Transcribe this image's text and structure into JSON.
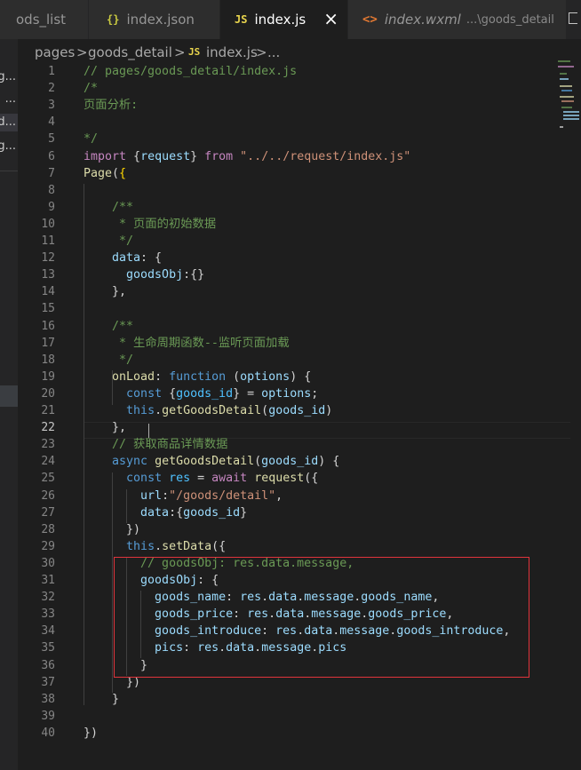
{
  "tabs": [
    {
      "label": "ods_list",
      "icon": "",
      "hint": "",
      "active": false
    },
    {
      "label": "index.json",
      "icon": "{}",
      "hint": "",
      "active": false
    },
    {
      "label": "index.js",
      "icon": "JS",
      "hint": "",
      "active": true,
      "close": "×"
    },
    {
      "label": "index.wxml",
      "icon": "<>",
      "hint": "...\\goods_detail",
      "active": false
    }
  ],
  "breadcrumb": {
    "part1": "pages",
    "sep": ">",
    "part2": "goods_detail",
    "icon": "JS",
    "file": "index.js",
    "ellipsis": "..."
  },
  "sidebar": {
    "items": [
      "g...",
      "...",
      "d...",
      "g..."
    ]
  },
  "editor": {
    "current_line": 22,
    "lines": [
      {
        "n": "1",
        "t": [
          [
            "// pages/goods_detail/index.js",
            "#6a9955"
          ]
        ]
      },
      {
        "n": "2",
        "t": [
          [
            "/*",
            "#6a9955"
          ]
        ]
      },
      {
        "n": "3",
        "t": [
          [
            "页面分析:",
            "#6a9955"
          ]
        ]
      },
      {
        "n": "4",
        "t": []
      },
      {
        "n": "5",
        "t": [
          [
            "*/",
            "#6a9955"
          ]
        ]
      },
      {
        "n": "6",
        "t": [
          [
            "import",
            "#c586c0"
          ],
          [
            " {",
            "#d4d4d4"
          ],
          [
            "request",
            "#9cdcfe"
          ],
          [
            "} ",
            "#d4d4d4"
          ],
          [
            "from",
            "#c586c0"
          ],
          [
            " ",
            "#d4d4d4"
          ],
          [
            "\"../../request/index.js\"",
            "#ce9178"
          ]
        ]
      },
      {
        "n": "7",
        "t": [
          [
            "Page",
            "#dcdcaa"
          ],
          [
            "(",
            "#d4d4d4"
          ],
          [
            "{",
            "#ffd700"
          ]
        ]
      },
      {
        "n": "8",
        "t": []
      },
      {
        "n": "9",
        "t": [
          [
            "    /**",
            "#6a9955"
          ]
        ]
      },
      {
        "n": "10",
        "t": [
          [
            "     * 页面的初始数据",
            "#6a9955"
          ]
        ]
      },
      {
        "n": "11",
        "t": [
          [
            "     */",
            "#6a9955"
          ]
        ]
      },
      {
        "n": "12",
        "t": [
          [
            "    data",
            "#9cdcfe"
          ],
          [
            ": {",
            "#d4d4d4"
          ]
        ]
      },
      {
        "n": "13",
        "t": [
          [
            "      goodsObj",
            "#9cdcfe"
          ],
          [
            ":{}",
            "#d4d4d4"
          ]
        ]
      },
      {
        "n": "14",
        "t": [
          [
            "    },",
            "#d4d4d4"
          ]
        ]
      },
      {
        "n": "15",
        "t": []
      },
      {
        "n": "16",
        "t": [
          [
            "    /**",
            "#6a9955"
          ]
        ]
      },
      {
        "n": "17",
        "t": [
          [
            "     * 生命周期函数--监听页面加载",
            "#6a9955"
          ]
        ]
      },
      {
        "n": "18",
        "t": [
          [
            "     */",
            "#6a9955"
          ]
        ]
      },
      {
        "n": "19",
        "t": [
          [
            "    onLoad",
            "#dcdcaa"
          ],
          [
            ": ",
            "#d4d4d4"
          ],
          [
            "function",
            "#569cd6"
          ],
          [
            " (",
            "#d4d4d4"
          ],
          [
            "options",
            "#9cdcfe"
          ],
          [
            ") {",
            "#d4d4d4"
          ]
        ]
      },
      {
        "n": "20",
        "t": [
          [
            "      ",
            "#d4d4d4"
          ],
          [
            "const",
            "#569cd6"
          ],
          [
            " {",
            "#d4d4d4"
          ],
          [
            "goods_id",
            "#4fc1ff"
          ],
          [
            "} = ",
            "#d4d4d4"
          ],
          [
            "options",
            "#9cdcfe"
          ],
          [
            ";",
            "#d4d4d4"
          ]
        ]
      },
      {
        "n": "21",
        "t": [
          [
            "      ",
            "#d4d4d4"
          ],
          [
            "this",
            "#569cd6"
          ],
          [
            ".",
            "#d4d4d4"
          ],
          [
            "getGoodsDetail",
            "#dcdcaa"
          ],
          [
            "(",
            "#d4d4d4"
          ],
          [
            "goods_id",
            "#9cdcfe"
          ],
          [
            ")",
            "#d4d4d4"
          ]
        ]
      },
      {
        "n": "22",
        "t": [
          [
            "    },",
            "#d4d4d4"
          ]
        ]
      },
      {
        "n": "23",
        "t": [
          [
            "    // 获取商品详情数据",
            "#6a9955"
          ]
        ]
      },
      {
        "n": "24",
        "t": [
          [
            "    ",
            "#d4d4d4"
          ],
          [
            "async",
            "#569cd6"
          ],
          [
            " ",
            "#d4d4d4"
          ],
          [
            "getGoodsDetail",
            "#dcdcaa"
          ],
          [
            "(",
            "#d4d4d4"
          ],
          [
            "goods_id",
            "#9cdcfe"
          ],
          [
            ") {",
            "#d4d4d4"
          ]
        ]
      },
      {
        "n": "25",
        "t": [
          [
            "      ",
            "#d4d4d4"
          ],
          [
            "const",
            "#569cd6"
          ],
          [
            " ",
            "#d4d4d4"
          ],
          [
            "res",
            "#4fc1ff"
          ],
          [
            " = ",
            "#d4d4d4"
          ],
          [
            "await",
            "#c586c0"
          ],
          [
            " ",
            "#d4d4d4"
          ],
          [
            "request",
            "#dcdcaa"
          ],
          [
            "({",
            "#d4d4d4"
          ]
        ]
      },
      {
        "n": "26",
        "t": [
          [
            "        url",
            "#9cdcfe"
          ],
          [
            ":",
            "#d4d4d4"
          ],
          [
            "\"/goods/detail\"",
            "#ce9178"
          ],
          [
            ",",
            "#d4d4d4"
          ]
        ]
      },
      {
        "n": "27",
        "t": [
          [
            "        data",
            "#9cdcfe"
          ],
          [
            ":{",
            "#d4d4d4"
          ],
          [
            "goods_id",
            "#9cdcfe"
          ],
          [
            "}",
            "#d4d4d4"
          ]
        ]
      },
      {
        "n": "28",
        "t": [
          [
            "      })",
            "#d4d4d4"
          ]
        ]
      },
      {
        "n": "29",
        "t": [
          [
            "      ",
            "#d4d4d4"
          ],
          [
            "this",
            "#569cd6"
          ],
          [
            ".",
            "#d4d4d4"
          ],
          [
            "setData",
            "#dcdcaa"
          ],
          [
            "({",
            "#d4d4d4"
          ]
        ]
      },
      {
        "n": "30",
        "t": [
          [
            "        // goodsObj: res.data.message,",
            "#6a9955"
          ]
        ]
      },
      {
        "n": "31",
        "t": [
          [
            "        goodsObj",
            "#9cdcfe"
          ],
          [
            ": {",
            "#d4d4d4"
          ]
        ]
      },
      {
        "n": "32",
        "t": [
          [
            "          goods_name",
            "#9cdcfe"
          ],
          [
            ": ",
            "#d4d4d4"
          ],
          [
            "res",
            "#9cdcfe"
          ],
          [
            ".",
            "#d4d4d4"
          ],
          [
            "data",
            "#9cdcfe"
          ],
          [
            ".",
            "#d4d4d4"
          ],
          [
            "message",
            "#9cdcfe"
          ],
          [
            ".",
            "#d4d4d4"
          ],
          [
            "goods_name",
            "#9cdcfe"
          ],
          [
            ",",
            "#d4d4d4"
          ]
        ]
      },
      {
        "n": "33",
        "t": [
          [
            "          goods_price",
            "#9cdcfe"
          ],
          [
            ": ",
            "#d4d4d4"
          ],
          [
            "res",
            "#9cdcfe"
          ],
          [
            ".",
            "#d4d4d4"
          ],
          [
            "data",
            "#9cdcfe"
          ],
          [
            ".",
            "#d4d4d4"
          ],
          [
            "message",
            "#9cdcfe"
          ],
          [
            ".",
            "#d4d4d4"
          ],
          [
            "goods_price",
            "#9cdcfe"
          ],
          [
            ",",
            "#d4d4d4"
          ]
        ]
      },
      {
        "n": "34",
        "t": [
          [
            "          goods_introduce",
            "#9cdcfe"
          ],
          [
            ": ",
            "#d4d4d4"
          ],
          [
            "res",
            "#9cdcfe"
          ],
          [
            ".",
            "#d4d4d4"
          ],
          [
            "data",
            "#9cdcfe"
          ],
          [
            ".",
            "#d4d4d4"
          ],
          [
            "message",
            "#9cdcfe"
          ],
          [
            ".",
            "#d4d4d4"
          ],
          [
            "goods_introduce",
            "#9cdcfe"
          ],
          [
            ",",
            "#d4d4d4"
          ]
        ]
      },
      {
        "n": "35",
        "t": [
          [
            "          pics",
            "#9cdcfe"
          ],
          [
            ": ",
            "#d4d4d4"
          ],
          [
            "res",
            "#9cdcfe"
          ],
          [
            ".",
            "#d4d4d4"
          ],
          [
            "data",
            "#9cdcfe"
          ],
          [
            ".",
            "#d4d4d4"
          ],
          [
            "message",
            "#9cdcfe"
          ],
          [
            ".",
            "#d4d4d4"
          ],
          [
            "pics",
            "#9cdcfe"
          ]
        ]
      },
      {
        "n": "36",
        "t": [
          [
            "        }",
            "#d4d4d4"
          ]
        ]
      },
      {
        "n": "37",
        "t": [
          [
            "      })",
            "#d4d4d4"
          ]
        ]
      },
      {
        "n": "38",
        "t": [
          [
            "    }",
            "#d4d4d4"
          ]
        ]
      },
      {
        "n": "39",
        "t": []
      },
      {
        "n": "40",
        "t": [
          [
            "})",
            "#d4d4d4"
          ]
        ]
      }
    ]
  },
  "colors": {
    "editor_bg": "#1e1e1e",
    "highlight_box": "#e0343c",
    "comment": "#6a9955",
    "keyword": "#569cd6"
  }
}
